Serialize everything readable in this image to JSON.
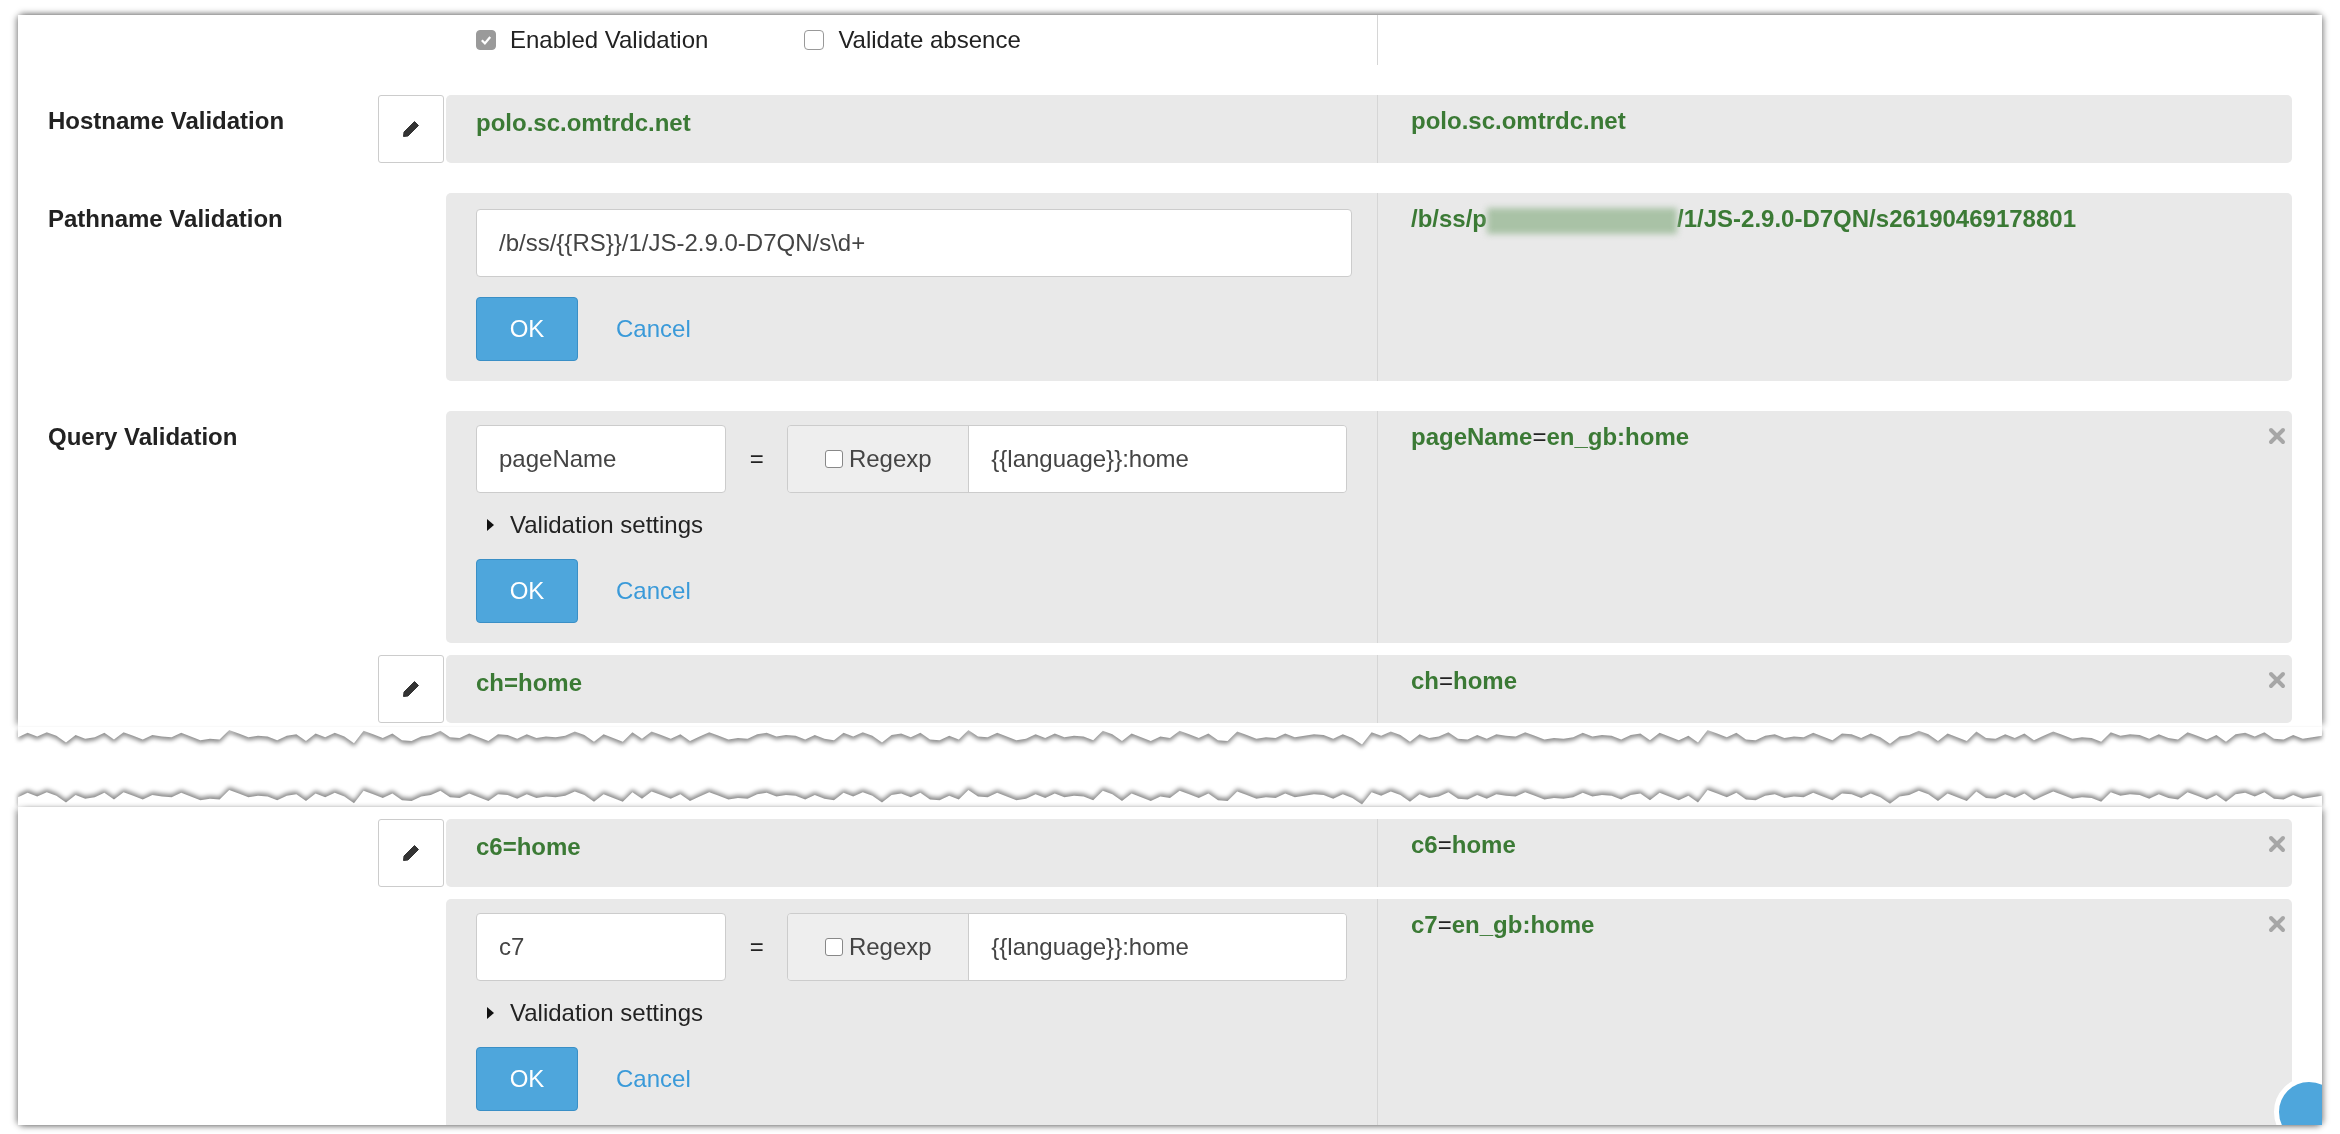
{
  "options": [
    {
      "label": "Enabled Validation",
      "checked": true,
      "disabled": true
    },
    {
      "label": "Validate absence",
      "checked": false,
      "disabled": false
    }
  ],
  "segments": [
    {
      "rows": [
        {
          "kind": "static",
          "label": "Hostname Validation",
          "value": "polo.sc.omtrdc.net",
          "result": "polo.sc.omtrdc.net"
        },
        {
          "kind": "path_edit",
          "label": "Pathname Validation",
          "input": "/b/ss/{{RS}}/1/JS-2.9.0-D7QN/s\\d+",
          "ok": "OK",
          "cancel": "Cancel",
          "result": {
            "prefix": "/b/ss/p",
            "redacted": true,
            "suffix": "/1/JS-2.9.0-D7QN/s26190469178801"
          }
        },
        {
          "kind": "query_edit",
          "label": "Query Validation",
          "key": "pageName",
          "sep": "=",
          "regexp": {
            "label": "Regexp",
            "checked": false
          },
          "value": "{{language}}:home",
          "settings": {
            "label": "Validation settings",
            "expanded": false
          },
          "ok": "OK",
          "cancel": "Cancel",
          "result": {
            "key": "pageName",
            "sep": "=",
            "value": "en_gb:home"
          },
          "removable": true
        },
        {
          "kind": "query",
          "key": "ch",
          "sep": "=",
          "value": "home",
          "result": {
            "key": "ch",
            "sep": "=",
            "value": "home"
          },
          "removable": true
        }
      ]
    },
    {
      "rows": [
        {
          "kind": "query",
          "key": "c6",
          "sep": "=",
          "value": "home",
          "result": {
            "key": "c6",
            "sep": "=",
            "value": "home"
          },
          "removable": true
        },
        {
          "kind": "query_edit",
          "key": "c7",
          "sep": "=",
          "regexp": {
            "label": "Regexp",
            "checked": false
          },
          "value": "{{language}}:home",
          "settings": {
            "label": "Validation settings",
            "expanded": false
          },
          "ok": "OK",
          "cancel": "Cancel",
          "result": {
            "key": "c7",
            "sep": "=",
            "value": "en_gb:home"
          },
          "removable": true
        }
      ]
    }
  ]
}
